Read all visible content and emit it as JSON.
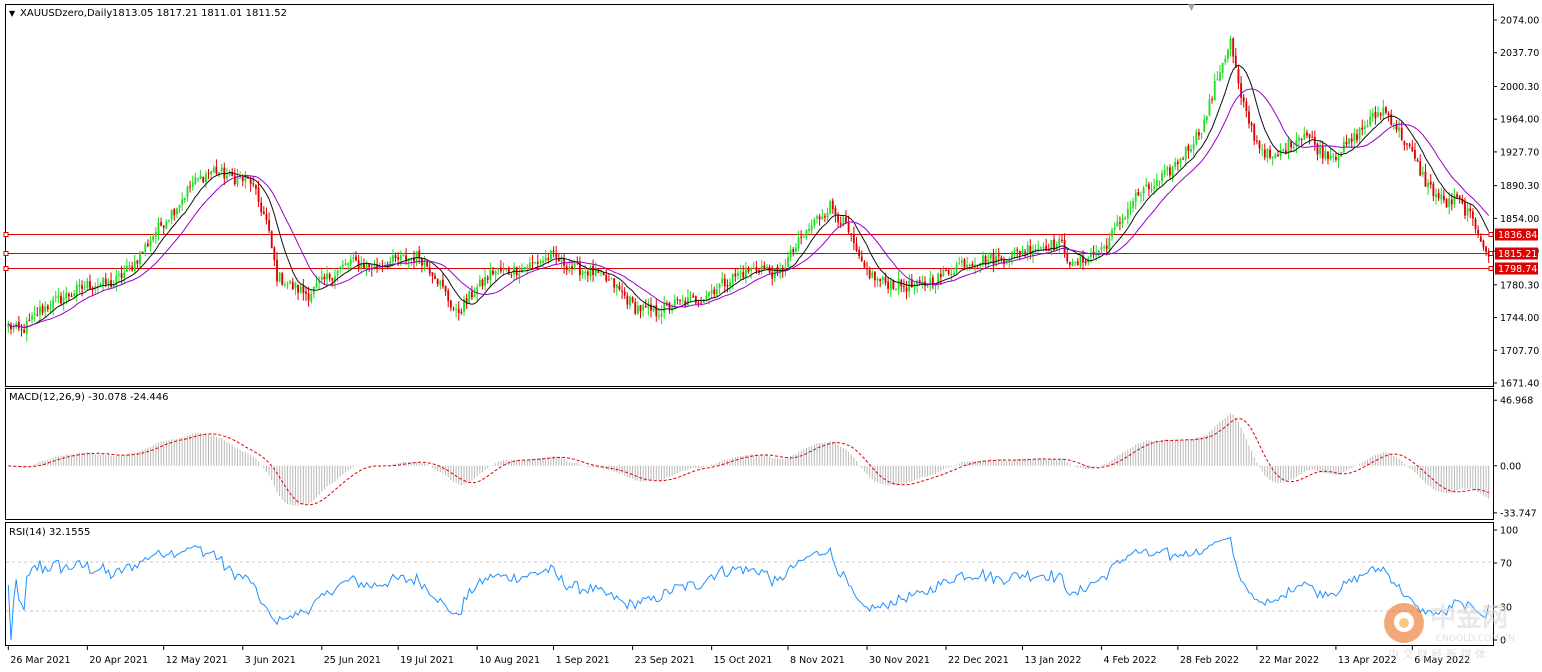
{
  "header": {
    "symbol": "XAUUSDzero,Daily",
    "ohlc": "1813.05 1817.21 1811.01 1811.52"
  },
  "colors": {
    "bull": "#22dd22",
    "bear": "#dd0000",
    "ma_fast": "#111111",
    "ma_slow": "#9900cc",
    "hline": "#dd0000",
    "rsi_line": "#1e90ff",
    "macd_hist": "#b8b8b8",
    "macd_signal": "#dd0000"
  },
  "chart_data": [
    {
      "type": "candlestick",
      "name": "price",
      "y_ticks": [
        "2074.00",
        "2037.70",
        "2000.30",
        "1964.00",
        "1927.70",
        "1890.30",
        "1854.00",
        "1817.60",
        "1780.30",
        "1744.00",
        "1707.70",
        "1671.40"
      ],
      "ylim": [
        1671.4,
        2074.0
      ],
      "x_tick_labels": [
        "26 Mar 2021",
        "20 Apr 2021",
        "12 May 2021",
        "3 Jun 2021",
        "25 Jun 2021",
        "19 Jul 2021",
        "10 Aug 2021",
        "1 Sep 2021",
        "23 Sep 2021",
        "15 Oct 2021",
        "8 Nov 2021",
        "30 Nov 2021",
        "22 Dec 2021",
        "13 Jan 2022",
        "4 Feb 2022",
        "28 Feb 2022",
        "22 Mar 2022",
        "13 Apr 2022",
        "6 May 2022"
      ],
      "close_path": [
        [
          0,
          1735
        ],
        [
          5,
          1728
        ],
        [
          12,
          1752
        ],
        [
          20,
          1765
        ],
        [
          30,
          1780
        ],
        [
          40,
          1782
        ],
        [
          48,
          1805
        ],
        [
          56,
          1840
        ],
        [
          64,
          1868
        ],
        [
          70,
          1893
        ],
        [
          78,
          1908
        ],
        [
          84,
          1900
        ],
        [
          92,
          1895
        ],
        [
          98,
          1850
        ],
        [
          102,
          1790
        ],
        [
          108,
          1778
        ],
        [
          114,
          1770
        ],
        [
          122,
          1790
        ],
        [
          130,
          1806
        ],
        [
          138,
          1800
        ],
        [
          148,
          1808
        ],
        [
          156,
          1812
        ],
        [
          162,
          1792
        ],
        [
          170,
          1748
        ],
        [
          176,
          1770
        ],
        [
          184,
          1795
        ],
        [
          190,
          1795
        ],
        [
          198,
          1802
        ],
        [
          206,
          1812
        ],
        [
          214,
          1800
        ],
        [
          222,
          1794
        ],
        [
          230,
          1780
        ],
        [
          238,
          1755
        ],
        [
          246,
          1750
        ],
        [
          254,
          1760
        ],
        [
          262,
          1764
        ],
        [
          270,
          1780
        ],
        [
          278,
          1793
        ],
        [
          286,
          1800
        ],
        [
          292,
          1790
        ],
        [
          298,
          1818
        ],
        [
          306,
          1850
        ],
        [
          312,
          1868
        ],
        [
          318,
          1845
        ],
        [
          324,
          1800
        ],
        [
          330,
          1785
        ],
        [
          338,
          1780
        ],
        [
          346,
          1778
        ],
        [
          354,
          1790
        ],
        [
          362,
          1805
        ],
        [
          370,
          1808
        ],
        [
          378,
          1810
        ],
        [
          386,
          1820
        ],
        [
          394,
          1824
        ],
        [
          400,
          1825
        ],
        [
          404,
          1800
        ],
        [
          410,
          1812
        ],
        [
          416,
          1822
        ],
        [
          422,
          1850
        ],
        [
          428,
          1878
        ],
        [
          436,
          1892
        ],
        [
          442,
          1910
        ],
        [
          448,
          1932
        ],
        [
          454,
          1960
        ],
        [
          460,
          2020
        ],
        [
          464,
          2050
        ],
        [
          468,
          1985
        ],
        [
          474,
          1938
        ],
        [
          480,
          1918
        ],
        [
          486,
          1935
        ],
        [
          492,
          1950
        ],
        [
          498,
          1928
        ],
        [
          504,
          1925
        ],
        [
          510,
          1940
        ],
        [
          516,
          1960
        ],
        [
          522,
          1975
        ],
        [
          526,
          1960
        ],
        [
          532,
          1930
        ],
        [
          538,
          1895
        ],
        [
          542,
          1880
        ],
        [
          546,
          1870
        ],
        [
          550,
          1875
        ],
        [
          554,
          1860
        ],
        [
          558,
          1840
        ],
        [
          562,
          1812
        ]
      ],
      "horizontal_lines": [
        {
          "label": "1836.84",
          "value": 1836.84
        },
        {
          "label": "1815.21",
          "value": 1815.21
        },
        {
          "label": "1798.74",
          "value": 1798.74
        }
      ]
    },
    {
      "type": "histogram+line",
      "name": "macd",
      "label": "MACD(12,26,9) -30.078 -24.446",
      "y_ticks": [
        "46.968",
        "0.00",
        "-33.747"
      ],
      "ylim": [
        -36,
        50
      ]
    },
    {
      "type": "line",
      "name": "rsi",
      "label": "RSI(14) 32.1555",
      "y_ticks": [
        "100",
        "70",
        "30",
        "0"
      ],
      "levels": [
        70,
        30
      ],
      "ylim": [
        0,
        100
      ]
    }
  ],
  "watermark": {
    "logo_text": "中金网",
    "domain": "CNGOLD.COM.CN",
    "tagline": "中 文 财 经 新 媒 体"
  }
}
